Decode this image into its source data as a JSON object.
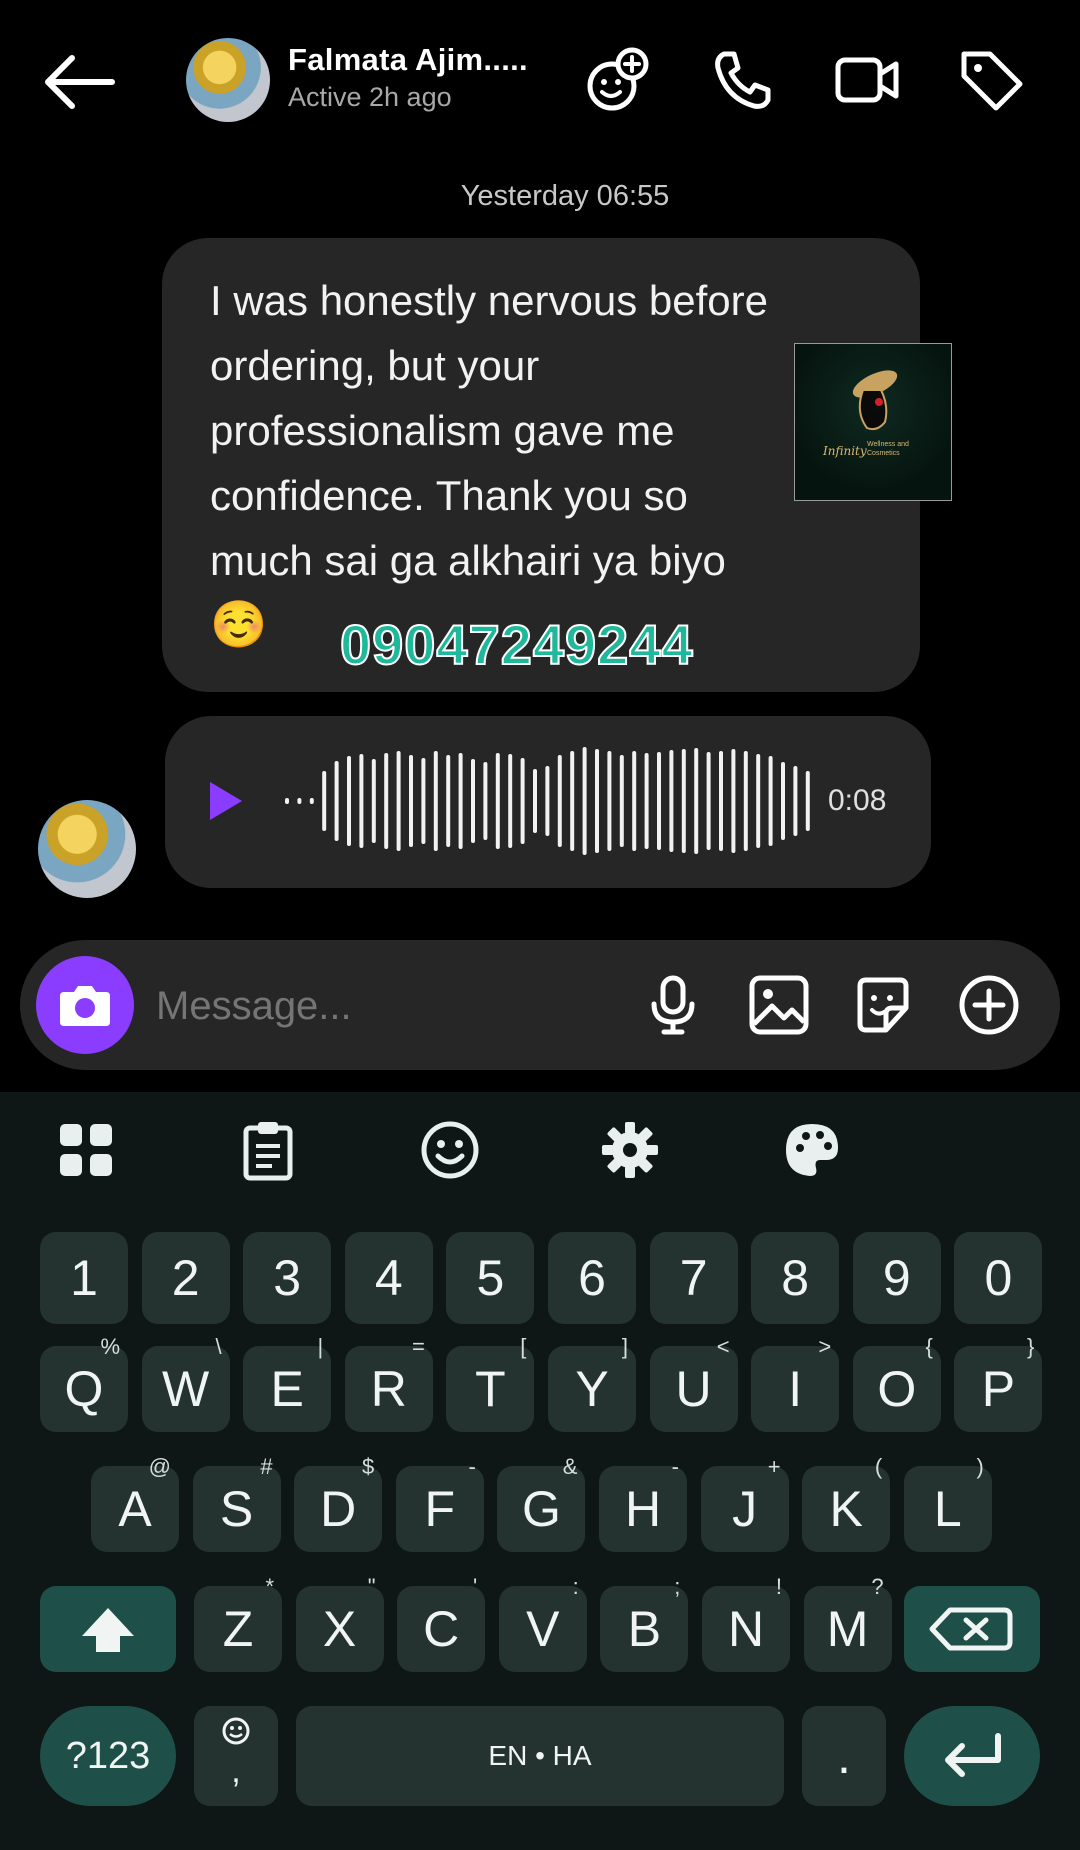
{
  "header": {
    "name": "Falmata Ajim.....",
    "status": "Active 2h ago",
    "icons": [
      "back-arrow-icon",
      "add-effect-icon",
      "phone-icon",
      "video-icon",
      "tag-icon"
    ]
  },
  "chat": {
    "timestamp": "Yesterday 06:55",
    "message_lines": [
      "I was honestly nervous before",
      "ordering, but your",
      "professionalism gave me",
      "confidence. Thank you so",
      "much sai ga alkhairi  ya biyo"
    ],
    "emoji": "☺️",
    "logo": {
      "script": "Infinity",
      "subtitle_1": "Wellness and",
      "subtitle_2": "Cosmetics"
    },
    "phone_overlay": "09047249244",
    "voice": {
      "duration": "0:08"
    }
  },
  "composer": {
    "placeholder": "Message...",
    "icons": [
      "camera-icon",
      "microphone-icon",
      "gallery-icon",
      "sticker-icon",
      "plus-icon"
    ]
  },
  "keyboard": {
    "toolbar": [
      "apps-icon",
      "clipboard-icon",
      "emoji-icon",
      "settings-icon",
      "theme-icon"
    ],
    "number_row": [
      "1",
      "2",
      "3",
      "4",
      "5",
      "6",
      "7",
      "8",
      "9",
      "0"
    ],
    "row1": [
      {
        "k": "Q",
        "s": "%"
      },
      {
        "k": "W",
        "s": "\\"
      },
      {
        "k": "E",
        "s": "|"
      },
      {
        "k": "R",
        "s": "="
      },
      {
        "k": "T",
        "s": "["
      },
      {
        "k": "Y",
        "s": "]"
      },
      {
        "k": "U",
        "s": "<"
      },
      {
        "k": "I",
        "s": ">"
      },
      {
        "k": "O",
        "s": "{"
      },
      {
        "k": "P",
        "s": "}"
      }
    ],
    "row2": [
      {
        "k": "A",
        "s": "@"
      },
      {
        "k": "S",
        "s": "#"
      },
      {
        "k": "D",
        "s": "$"
      },
      {
        "k": "F",
        "s": "-"
      },
      {
        "k": "G",
        "s": "&"
      },
      {
        "k": "H",
        "s": "-"
      },
      {
        "k": "J",
        "s": "+"
      },
      {
        "k": "K",
        "s": "("
      },
      {
        "k": "L",
        "s": ")"
      }
    ],
    "row3": [
      {
        "k": "Z",
        "s": "*"
      },
      {
        "k": "X",
        "s": "\""
      },
      {
        "k": "C",
        "s": "'"
      },
      {
        "k": "V",
        "s": ":"
      },
      {
        "k": "B",
        "s": ";"
      },
      {
        "k": "N",
        "s": "!"
      },
      {
        "k": "M",
        "s": "?"
      }
    ],
    "symbols_label": "?123",
    "comma_key": ",",
    "space_label": "EN • HA",
    "period_key": "."
  },
  "colors": {
    "accent": "#8b3dff",
    "phone_overlay": "#1fb89a",
    "key_bg": "#243330",
    "key_dark": "#1e4f48"
  }
}
